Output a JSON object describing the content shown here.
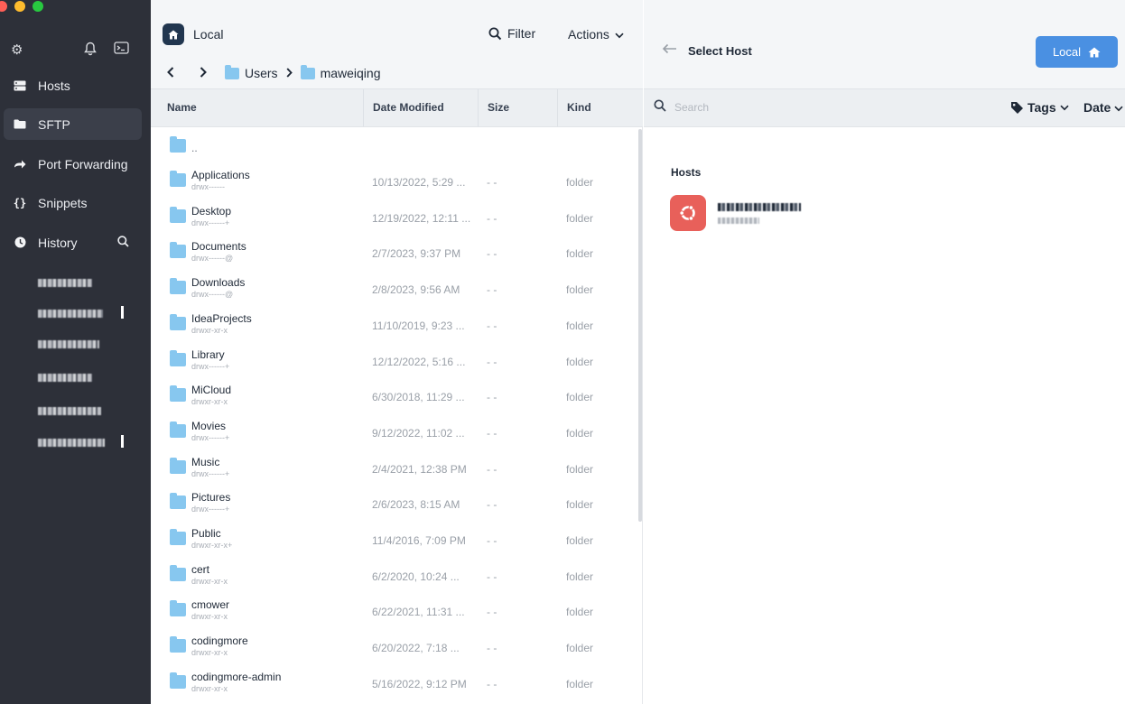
{
  "sidebar": {
    "nav": [
      {
        "label": "Hosts",
        "icon": "hosts-icon"
      },
      {
        "label": "SFTP",
        "icon": "folder-icon"
      },
      {
        "label": "Port Forwarding",
        "icon": "port-forward-icon"
      },
      {
        "label": "Snippets",
        "icon": "snippets-icon"
      },
      {
        "label": "History",
        "icon": "history-icon"
      }
    ],
    "snippets_glyph": "{}"
  },
  "filepane": {
    "title": "Local",
    "filter_label": "Filter",
    "actions_label": "Actions",
    "breadcrumb": [
      "Users",
      "maweiqing"
    ],
    "columns": {
      "name": "Name",
      "date": "Date Modified",
      "size": "Size",
      "kind": "Kind"
    },
    "parent_label": "..",
    "files": [
      {
        "name": "Applications",
        "perm": "drwx------",
        "date": "10/13/2022, 5:29 ...",
        "size": "- -",
        "kind": "folder"
      },
      {
        "name": "Desktop",
        "perm": "drwx------+",
        "date": "12/19/2022, 12:11 ...",
        "size": "- -",
        "kind": "folder"
      },
      {
        "name": "Documents",
        "perm": "drwx------@",
        "date": "2/7/2023, 9:37 PM",
        "size": "- -",
        "kind": "folder"
      },
      {
        "name": "Downloads",
        "perm": "drwx------@",
        "date": "2/8/2023, 9:56 AM",
        "size": "- -",
        "kind": "folder"
      },
      {
        "name": "IdeaProjects",
        "perm": "drwxr-xr-x",
        "date": "11/10/2019, 9:23 ...",
        "size": "- -",
        "kind": "folder"
      },
      {
        "name": "Library",
        "perm": "drwx------+",
        "date": "12/12/2022, 5:16 ...",
        "size": "- -",
        "kind": "folder"
      },
      {
        "name": "MiCloud",
        "perm": "drwxr-xr-x",
        "date": "6/30/2018, 11:29 ...",
        "size": "- -",
        "kind": "folder"
      },
      {
        "name": "Movies",
        "perm": "drwx------+",
        "date": "9/12/2022, 11:02 ...",
        "size": "- -",
        "kind": "folder"
      },
      {
        "name": "Music",
        "perm": "drwx------+",
        "date": "2/4/2021, 12:38 PM",
        "size": "- -",
        "kind": "folder"
      },
      {
        "name": "Pictures",
        "perm": "drwx------+",
        "date": "2/6/2023, 8:15 AM",
        "size": "- -",
        "kind": "folder"
      },
      {
        "name": "Public",
        "perm": "drwxr-xr-x+",
        "date": "11/4/2016, 7:09 PM",
        "size": "- -",
        "kind": "folder"
      },
      {
        "name": "cert",
        "perm": "drwxr-xr-x",
        "date": "6/2/2020, 10:24 ...",
        "size": "- -",
        "kind": "folder"
      },
      {
        "name": "cmower",
        "perm": "drwxr-xr-x",
        "date": "6/22/2021, 11:31 ...",
        "size": "- -",
        "kind": "folder"
      },
      {
        "name": "codingmore",
        "perm": "drwxr-xr-x",
        "date": "6/20/2022, 7:18 ...",
        "size": "- -",
        "kind": "folder"
      },
      {
        "name": "codingmore-admin",
        "perm": "drwxr-xr-x",
        "date": "5/16/2022, 9:12 PM",
        "size": "- -",
        "kind": "folder"
      }
    ]
  },
  "hostpane": {
    "title": "Select Host",
    "local_button": "Local",
    "search_placeholder": "Search",
    "tags_label": "Tags",
    "date_label": "Date",
    "hosts_section": "Hosts"
  },
  "colors": {
    "sidebar_bg": "#2d3039",
    "accent": "#4a90e2",
    "folder": "#87c7ef",
    "host_logo": "#e8605a"
  }
}
